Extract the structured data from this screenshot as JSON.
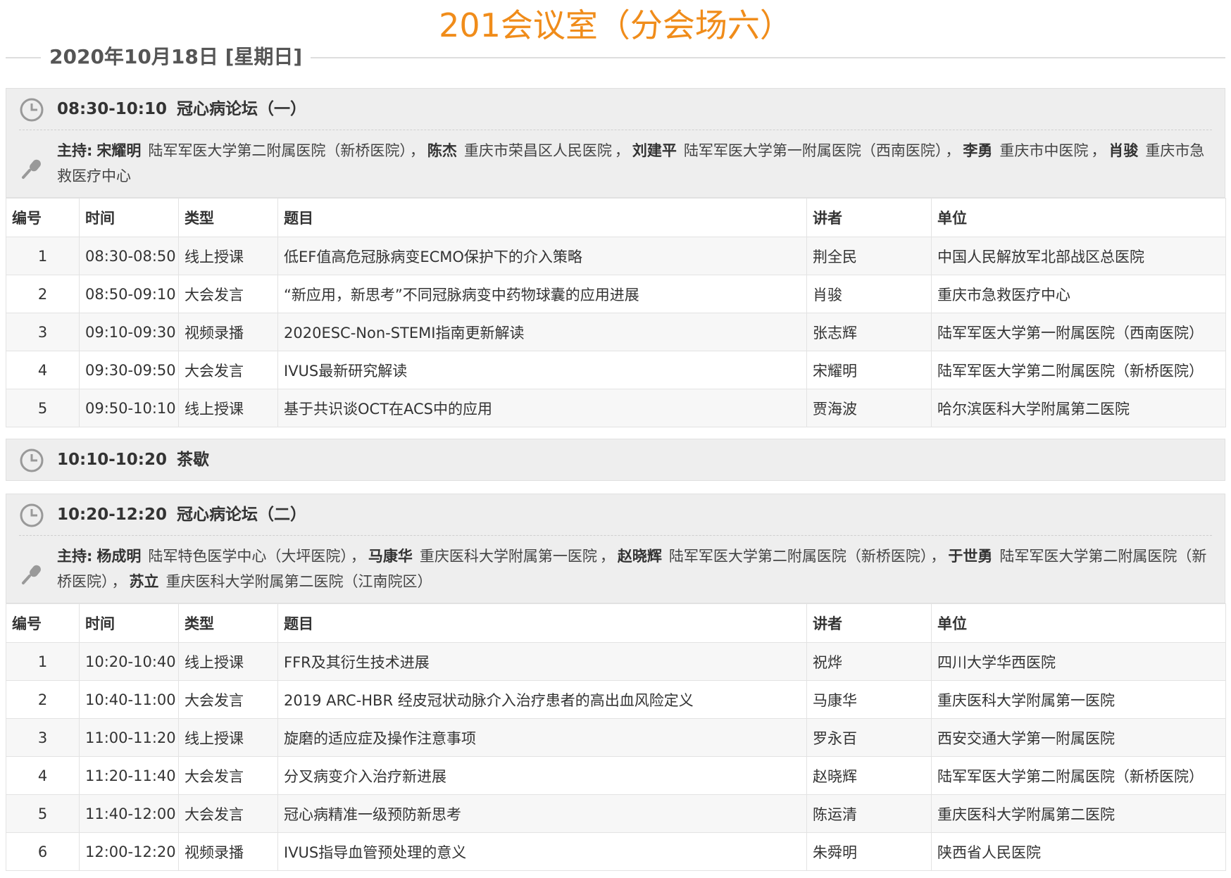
{
  "page_title": "201会议室（分会场六）",
  "date": "2020年10月18日 [星期日]",
  "columns": {
    "no": "编号",
    "time": "时间",
    "type": "类型",
    "title": "题目",
    "speaker": "讲者",
    "unit": "单位"
  },
  "host_label": "主持:",
  "sessions": [
    {
      "time": "08:30-10:10",
      "name": "冠心病论坛（一）",
      "hosts": [
        {
          "name": "宋耀明",
          "unit": "陆军军医大学第二附属医院（新桥医院）"
        },
        {
          "name": "陈杰",
          "unit": "重庆市荣昌区人民医院"
        },
        {
          "name": "刘建平",
          "unit": "陆军军医大学第一附属医院（西南医院）"
        },
        {
          "name": "李勇",
          "unit": "重庆市中医院"
        },
        {
          "name": "肖骏",
          "unit": "重庆市急救医疗中心"
        }
      ],
      "rows": [
        {
          "no": "1",
          "time": "08:30-08:50",
          "type": "线上授课",
          "title": "低EF值高危冠脉病变ECMO保护下的介入策略",
          "speaker": "荆全民",
          "unit": "中国人民解放军北部战区总医院"
        },
        {
          "no": "2",
          "time": "08:50-09:10",
          "type": "大会发言",
          "title": "“新应用，新思考”不同冠脉病变中药物球囊的应用进展",
          "speaker": "肖骏",
          "unit": "重庆市急救医疗中心"
        },
        {
          "no": "3",
          "time": "09:10-09:30",
          "type": "视频录播",
          "title": "2020ESC-Non-STEMI指南更新解读",
          "speaker": "张志辉",
          "unit": "陆军军医大学第一附属医院（西南医院）"
        },
        {
          "no": "4",
          "time": "09:30-09:50",
          "type": "大会发言",
          "title": "IVUS最新研究解读",
          "speaker": "宋耀明",
          "unit": "陆军军医大学第二附属医院（新桥医院）"
        },
        {
          "no": "5",
          "time": "09:50-10:10",
          "type": "线上授课",
          "title": "基于共识谈OCT在ACS中的应用",
          "speaker": "贾海波",
          "unit": "哈尔滨医科大学附属第二医院"
        }
      ]
    },
    {
      "time": "10:10-10:20",
      "name": "茶歇"
    },
    {
      "time": "10:20-12:20",
      "name": "冠心病论坛（二）",
      "hosts": [
        {
          "name": "杨成明",
          "unit": "陆军特色医学中心（大坪医院）"
        },
        {
          "name": "马康华",
          "unit": "重庆医科大学附属第一医院"
        },
        {
          "name": "赵晓辉",
          "unit": "陆军军医大学第二附属医院（新桥医院）"
        },
        {
          "name": "于世勇",
          "unit": "陆军军医大学第二附属医院（新桥医院）"
        },
        {
          "name": "苏立",
          "unit": "重庆医科大学附属第二医院（江南院区）"
        }
      ],
      "rows": [
        {
          "no": "1",
          "time": "10:20-10:40",
          "type": "线上授课",
          "title": "FFR及其衍生技术进展",
          "speaker": "祝烨",
          "unit": "四川大学华西医院"
        },
        {
          "no": "2",
          "time": "10:40-11:00",
          "type": "大会发言",
          "title": "2019 ARC-HBR 经皮冠状动脉介入治疗患者的高出血风险定义",
          "speaker": "马康华",
          "unit": "重庆医科大学附属第一医院"
        },
        {
          "no": "3",
          "time": "11:00-11:20",
          "type": "线上授课",
          "title": "旋磨的适应症及操作注意事项",
          "speaker": "罗永百",
          "unit": "西安交通大学第一附属医院"
        },
        {
          "no": "4",
          "time": "11:20-11:40",
          "type": "大会发言",
          "title": "分叉病变介入治疗新进展",
          "speaker": "赵晓辉",
          "unit": "陆军军医大学第二附属医院（新桥医院）"
        },
        {
          "no": "5",
          "time": "11:40-12:00",
          "type": "大会发言",
          "title": "冠心病精准一级预防新思考",
          "speaker": "陈运清",
          "unit": "重庆医科大学附属第二医院"
        },
        {
          "no": "6",
          "time": "12:00-12:20",
          "type": "视频录播",
          "title": "IVUS指导血管预处理的意义",
          "speaker": "朱舜明",
          "unit": "陕西省人民医院"
        }
      ]
    }
  ],
  "colors": {
    "title": "#f08c1a",
    "header_bg": "#eeeeee",
    "row_alt": "#f7f7f7"
  },
  "icons": {
    "time": "clock-icon",
    "host": "microphone-icon"
  }
}
